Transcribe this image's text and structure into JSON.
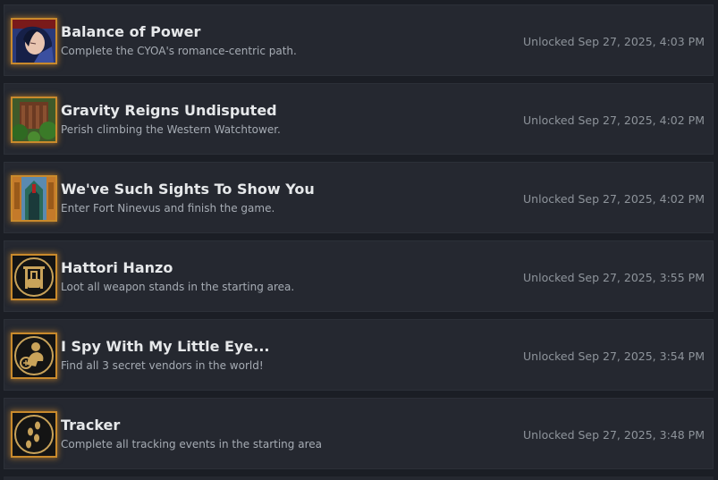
{
  "achievements": [
    {
      "title": "Balance of Power",
      "description": "Complete the CYOA's romance-centric path.",
      "unlocked": "Unlocked Sep 27, 2025, 4:03 PM",
      "icon": "portrait-icon"
    },
    {
      "title": "Gravity Reigns Undisputed",
      "description": "Perish climbing the Western Watchtower.",
      "unlocked": "Unlocked Sep 27, 2025, 4:02 PM",
      "icon": "watchtower-icon"
    },
    {
      "title": "We've Such Sights To Show You",
      "description": "Enter Fort Ninevus and finish the game.",
      "unlocked": "Unlocked Sep 27, 2025, 4:02 PM",
      "icon": "fort-gate-icon"
    },
    {
      "title": "Hattori Hanzo",
      "description": "Loot all weapon stands in the starting area.",
      "unlocked": "Unlocked Sep 27, 2025, 3:55 PM",
      "icon": "weapon-stand-icon"
    },
    {
      "title": "I Spy With My Little Eye...",
      "description": "Find all 3 secret vendors in the world!",
      "unlocked": "Unlocked Sep 27, 2025, 3:54 PM",
      "icon": "vendor-icon"
    },
    {
      "title": "Tracker",
      "description": "Complete all tracking events in the starting area",
      "unlocked": "Unlocked Sep 27, 2025, 3:48 PM",
      "icon": "footprints-icon"
    }
  ],
  "colors": {
    "row_bg": "#252830",
    "page_bg": "#1b1e25",
    "icon_border": "#c98a2c",
    "title": "#e6e8ea",
    "desc": "#a6acb4",
    "date": "#8e949b"
  }
}
